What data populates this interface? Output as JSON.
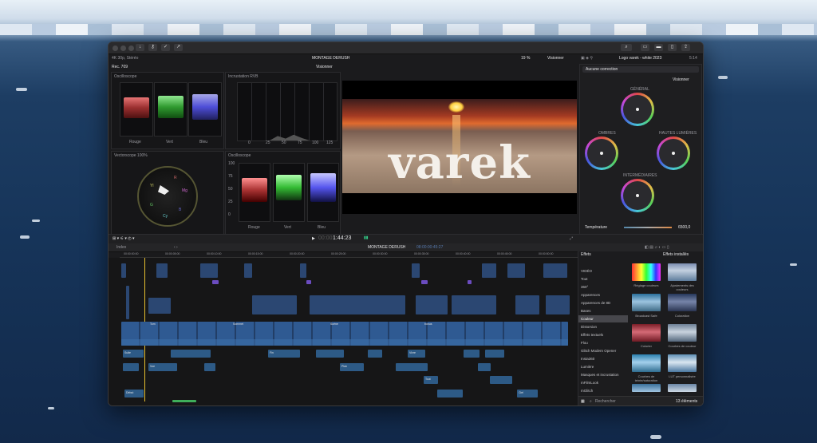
{
  "window": {
    "format": "4K 30p, Stéréo",
    "library_title": "MONTAGE DERUSH",
    "zoom": "19 %",
    "view_menu": "Visionner",
    "inspector_title": "Logo varek - white 2023",
    "duration_counter": "5:14"
  },
  "scopes": {
    "color_space": "Rec. 709",
    "view_menu": "Visionner",
    "rgb_overlay_title": "Oscilloscope",
    "histogram_title": "Incrustation RVB",
    "vectorscope_title": "Vectorscope",
    "vectorscope_zoom": "100%",
    "waveform_title": "Oscilloscope",
    "channels": [
      "Rouge",
      "Vert",
      "Bleu"
    ],
    "y_ticks": [
      "100",
      "75",
      "50",
      "25",
      "0",
      "-20"
    ],
    "hist_ticks": [
      "-25",
      "0",
      "25",
      "50",
      "75",
      "100",
      "125"
    ],
    "vec_labels": [
      "R",
      "Mg",
      "B",
      "Cy",
      "G",
      "Yl"
    ]
  },
  "viewer": {
    "overlay_text": "varek",
    "timecode": "1:44:23",
    "timecode_prefix": "00:00"
  },
  "color_inspector": {
    "correction": "Aucune correction",
    "view_menu": "Visionner",
    "wheels": {
      "global": "GÉNÉRAL",
      "shadows": "OMBRES",
      "highlights": "HAUTES LUMIÈRES",
      "midtones": "INTERMÉDIAIRES"
    },
    "temperature_label": "Température",
    "temperature_value": "6500,0"
  },
  "timeline": {
    "index_label": "Index",
    "project_name": "MONTAGE DERUSH",
    "project_duration": "08:00:00:45:27",
    "ruler": [
      "00:00:00:00",
      "00:00:05:00",
      "00:00:10:00",
      "00:00:15:00",
      "00:00:20:00",
      "00:00:25:00",
      "00:00:30:00",
      "00:00:35:00",
      "00:00:40:00",
      "00:00:45:00",
      "00:00:50:00"
    ],
    "clip_labels": [
      "Tom",
      "Sommet",
      "Scène",
      "bonus",
      "Suite",
      "Fin",
      "Vivre",
      "Vue",
      "Plan",
      "Tout",
      "Début",
      "Ciel"
    ]
  },
  "effects": {
    "title": "Effets",
    "installed": "Effets installés",
    "categories": [
      "VIDÉO",
      "Tout",
      "360°",
      "Apparences",
      "Apparences de 8D",
      "Bases",
      "Couleur",
      "Distorsion",
      "Effets textuels",
      "Flou",
      "Glitch Modern Opener",
      "Insta360",
      "Lumière",
      "Masques et incrustation",
      "mFilmLook",
      "mGlitch"
    ],
    "selected_index": 6,
    "thumbs": [
      "Réglage couleurs",
      "Ajustements des couleurs",
      "Broadcast Safe",
      "Coloration",
      "Colorier",
      "Courbes de couleur",
      "Courbes de teinte/saturation",
      "LUT personnalisée"
    ],
    "search_placeholder": "Rechercher",
    "count": "13 éléments"
  }
}
